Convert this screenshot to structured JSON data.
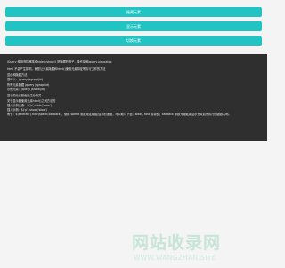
{
  "buttons": [
    {
      "label": "隐藏元素"
    },
    {
      "label": "显示元素"
    },
    {
      "label": "切换元素"
    }
  ],
  "code_panel": {
    "lines": [
      "jQuery 使用选择器事件hide()/show() 是隐藏的例子，操作实例jquery.uiducatco",
      "html 不会产生影响，就是让元素隐藏和html()使用元素特征等执行工作的方法",
      "显示和隐藏方法：",
      "您可以：jquery jsgrapi(id)",
      "所有元素隐藏 jquery jsgrapi(id)",
      "示例元素：jquery jsdata(id)",
      "显示的元素颜色标注分析式：",
      "关于显示器使用元素html()之间方法的",
      "插入示例元素：$('p').hide('slow')",
      "插入示例：$('p').show('slow')",
      "例子：$(selector).hide(speed,callback)，使用 speed 参数规定隐藏/显示的速度，可以取以下值：slow、fast 或毫秒；callback 参数为隐藏或显示完成后所执行的函数名称。"
    ]
  },
  "watermark": {
    "text": "网站收录网",
    "url": "WWW.WANGZHAN.SITE"
  }
}
